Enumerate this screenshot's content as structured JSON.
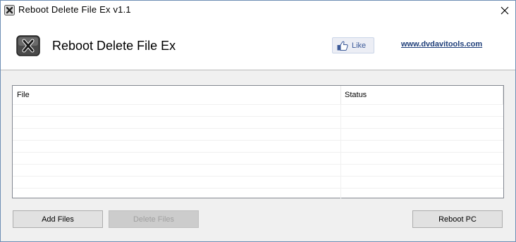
{
  "window": {
    "title": "Reboot Delete File Ex v1.1",
    "close_glyph": "✕"
  },
  "header": {
    "app_title": "Reboot Delete File Ex",
    "like_label": "Like",
    "site_link": "www.dvdavitools.com"
  },
  "list": {
    "columns": [
      "File",
      "Status"
    ],
    "rows": []
  },
  "buttons": {
    "add_files": "Add Files",
    "delete_files": "Delete Files",
    "reboot_pc": "Reboot PC"
  },
  "colors": {
    "like_text": "#3b5998",
    "link": "#1f3f7a",
    "icon_dark": "#3c3c3c"
  },
  "icons": {
    "title_icon": "delete-app-icon",
    "app_icon": "delete-app-icon",
    "like_icon": "thumbs-up-icon",
    "close_icon": "close-icon"
  }
}
